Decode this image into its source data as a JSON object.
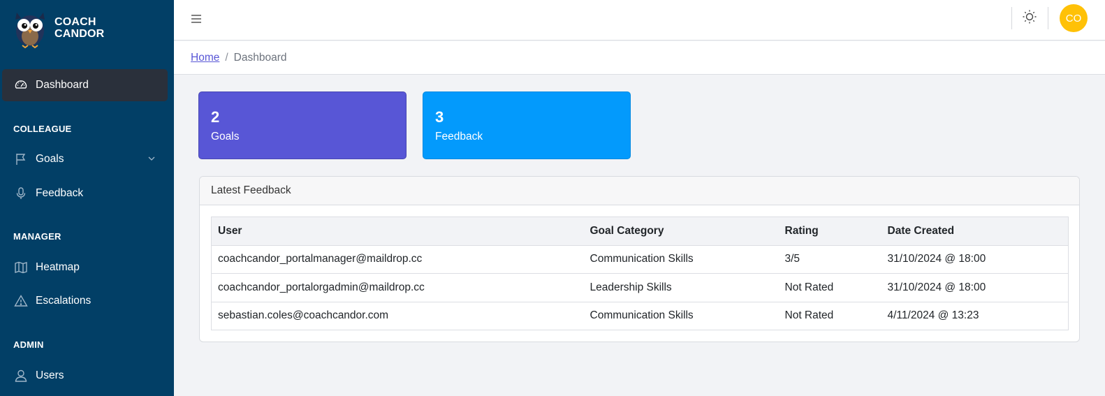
{
  "brand": {
    "line1": "COACH",
    "line2": "CANDOR"
  },
  "sidebar": {
    "dashboard": "Dashboard",
    "section_colleague": "COLLEAGUE",
    "goals": "Goals",
    "feedback": "Feedback",
    "section_manager": "MANAGER",
    "heatmap": "Heatmap",
    "escalations": "Escalations",
    "section_admin": "ADMIN",
    "users": "Users"
  },
  "header": {
    "avatar_initials": "CO"
  },
  "breadcrumb": {
    "home": "Home",
    "separator": "/",
    "current": "Dashboard"
  },
  "stats": [
    {
      "value": "2",
      "label": "Goals",
      "color": "#5856d6"
    },
    {
      "value": "3",
      "label": "Feedback",
      "color": "#039afc"
    }
  ],
  "latest_feedback": {
    "title": "Latest Feedback",
    "columns": [
      "User",
      "Goal Category",
      "Rating",
      "Date Created"
    ],
    "rows": [
      [
        "coachcandor_portalmanager@maildrop.cc",
        "Communication Skills",
        "3/5",
        "31/10/2024 @ 18:00"
      ],
      [
        "coachcandor_portalorgadmin@maildrop.cc",
        "Leadership Skills",
        "Not Rated",
        "31/10/2024 @ 18:00"
      ],
      [
        "sebastian.coles@coachcandor.com",
        "Communication Skills",
        "Not Rated",
        "4/11/2024 @ 13:23"
      ]
    ]
  },
  "colors": {
    "sidebar_bg": "#023f66",
    "active_item_bg": "#2a303b",
    "accent": "#5856d6",
    "avatar_bg": "#ffc107"
  }
}
